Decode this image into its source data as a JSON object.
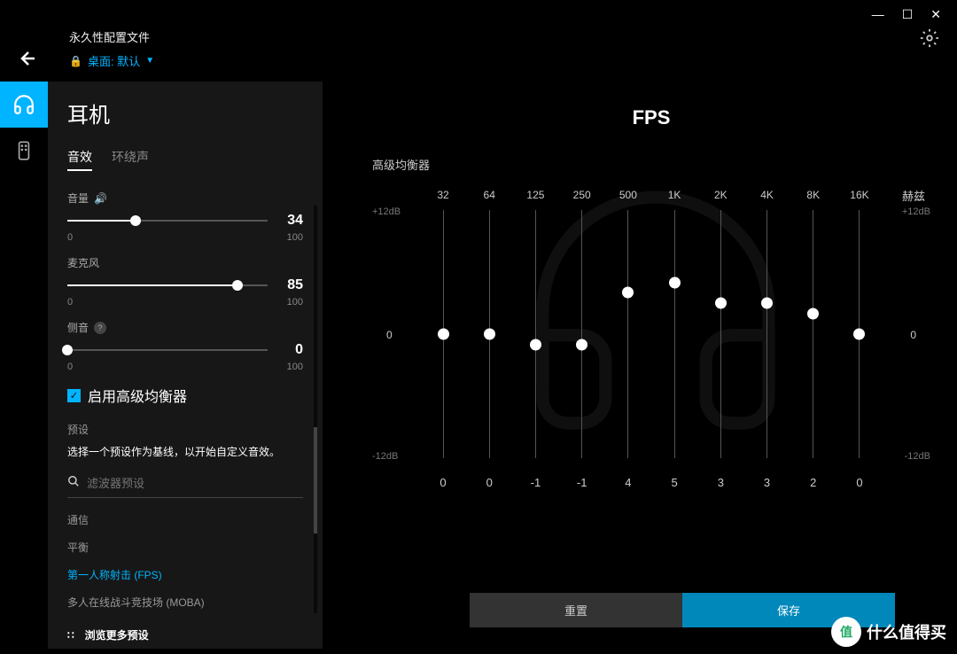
{
  "window": {
    "min": "—",
    "max": "☐",
    "close": "✕"
  },
  "header": {
    "profile_title": "永久性配置文件",
    "desktop_prefix": "桌面:",
    "desktop_value": "默认"
  },
  "panel": {
    "title": "耳机",
    "tabs": {
      "sound": "音效",
      "surround": "环绕声"
    },
    "sliders": {
      "volume": {
        "label": "音量",
        "value": "34",
        "min": "0",
        "max": "100",
        "pct": 34
      },
      "mic": {
        "label": "麦克风",
        "value": "85",
        "min": "0",
        "max": "100",
        "pct": 85
      },
      "sidetone": {
        "label": "侧音",
        "value": "0",
        "min": "0",
        "max": "100",
        "pct": 0
      }
    },
    "eq_checkbox": "启用高级均衡器",
    "preset_label": "预设",
    "preset_desc": "选择一个预设作为基线，以开始自定义音效。",
    "search_placeholder": "滤波器预设",
    "presets": [
      "通信",
      "平衡",
      "第一人称射击 (FPS)",
      "多人在线战斗竞技场 (MOBA)"
    ],
    "active_preset": 2,
    "browse_more": "浏览更多预设"
  },
  "eq": {
    "title": "FPS",
    "subtitle": "高级均衡器",
    "hz_label": "赫兹",
    "db_top": "+12dB",
    "db_mid": "0",
    "db_bot": "-12dB",
    "bands": [
      {
        "freq": "32",
        "value": "0",
        "db": 0
      },
      {
        "freq": "64",
        "value": "0",
        "db": 0
      },
      {
        "freq": "125",
        "value": "-1",
        "db": -1
      },
      {
        "freq": "250",
        "value": "-1",
        "db": -1
      },
      {
        "freq": "500",
        "value": "4",
        "db": 4
      },
      {
        "freq": "1K",
        "value": "5",
        "db": 5
      },
      {
        "freq": "2K",
        "value": "3",
        "db": 3
      },
      {
        "freq": "4K",
        "value": "3",
        "db": 3
      },
      {
        "freq": "8K",
        "value": "2",
        "db": 2
      },
      {
        "freq": "16K",
        "value": "0",
        "db": 0
      }
    ],
    "reset": "重置",
    "save": "保存"
  },
  "watermark": {
    "badge": "值",
    "text": "什么值得买"
  }
}
